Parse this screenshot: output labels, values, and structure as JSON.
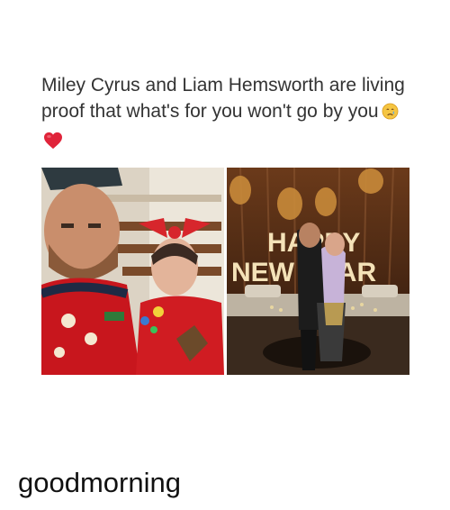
{
  "post": {
    "caption_line1": "Miley Cyrus and Liam Hemsworth are living",
    "caption_line2": "proof that what's for you won't go by you",
    "caption_emoji": "crying-face-emoji",
    "heart_emoji": "red-heart-emoji",
    "photo_left": "christmas-sweater-selfie",
    "photo_right": "happy-new-year-kiss"
  },
  "sign_text": {
    "line1": "HAPPY",
    "line2": "NEW YEAR"
  },
  "footer": {
    "text": "goodmorning"
  },
  "colors": {
    "text": "#333333",
    "heart": "#e0243a",
    "sweater": "#c8161d"
  }
}
